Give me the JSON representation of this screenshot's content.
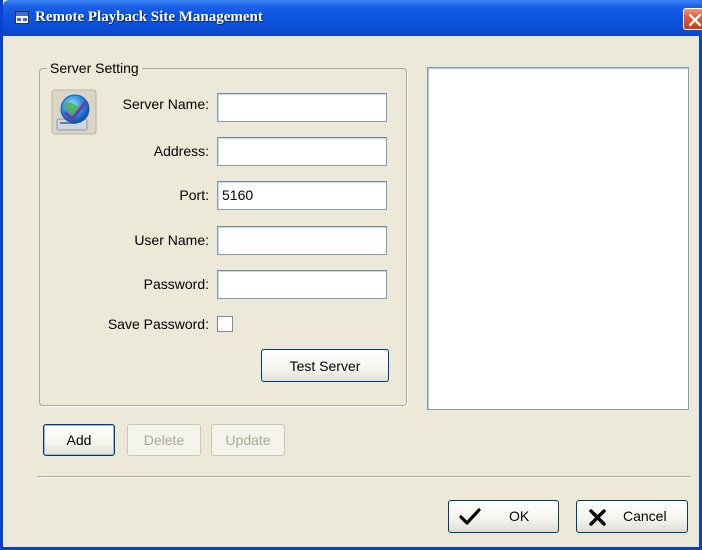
{
  "window": {
    "title": "Remote Playback Site Management",
    "icons": {
      "app": "app-window-icon",
      "close": "close-icon"
    },
    "colors": {
      "titlebar": "#0b4ed8",
      "close": "#e25a36",
      "background": "#ece9d8"
    }
  },
  "server_setting": {
    "legend": "Server Setting",
    "icon": "server-globe-icon",
    "fields": {
      "server_name": {
        "label": "Server Name:",
        "value": ""
      },
      "address": {
        "label": "Address:",
        "value": ""
      },
      "port": {
        "label": "Port:",
        "value": "5160"
      },
      "user_name": {
        "label": "User Name:",
        "value": ""
      },
      "password": {
        "label": "Password:",
        "value": ""
      }
    },
    "save_password": {
      "label": "Save Password:",
      "checked": false
    },
    "test_server_label": "Test Server"
  },
  "site_list": {
    "items": []
  },
  "actions": {
    "add_label": "Add",
    "delete_label": "Delete",
    "update_label": "Update",
    "delete_enabled": false,
    "update_enabled": false
  },
  "dialog_buttons": {
    "ok_label": "OK",
    "ok_icon": "check-icon",
    "cancel_label": "Cancel",
    "cancel_icon": "x-icon"
  }
}
